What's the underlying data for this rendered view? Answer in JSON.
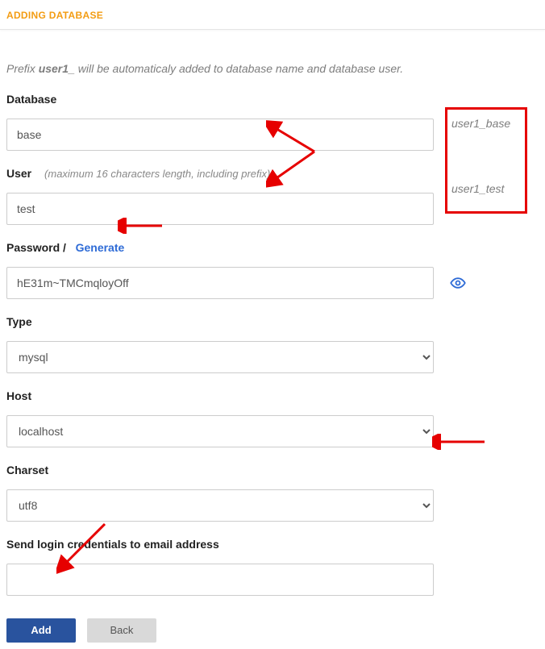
{
  "header": {
    "title": "ADDING DATABASE"
  },
  "prefix_note": {
    "lead": "Prefix ",
    "prefix": "user1_",
    "trail": " will be automaticaly added to database name and database user."
  },
  "fields": {
    "database": {
      "label": "Database",
      "value": "base"
    },
    "user": {
      "label": "User",
      "hint": "(maximum 16 characters length, including prefix)",
      "value": "test"
    },
    "password": {
      "label": "Password",
      "separator": "/",
      "generate": "Generate",
      "value": "hE31m~TMCmqloyOff"
    },
    "type": {
      "label": "Type",
      "value": "mysql"
    },
    "host": {
      "label": "Host",
      "value": "localhost"
    },
    "charset": {
      "label": "Charset",
      "value": "utf8"
    },
    "email": {
      "label": "Send login credentials to email address",
      "value": ""
    }
  },
  "buttons": {
    "add": "Add",
    "back": "Back"
  },
  "annotations": {
    "db_preview": "user1_base",
    "user_preview": "user1_test"
  }
}
